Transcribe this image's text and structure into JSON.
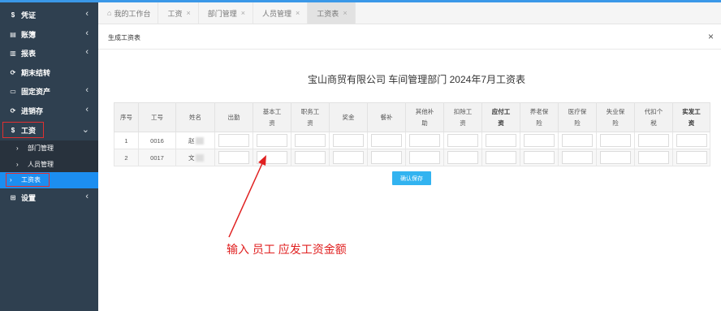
{
  "sidebar": {
    "items": [
      {
        "label": "凭证",
        "icon": "dollar-icon",
        "glyph": "$"
      },
      {
        "label": "账簿",
        "icon": "book-icon",
        "glyph": "▤"
      },
      {
        "label": "报表",
        "icon": "report-icon",
        "glyph": "▥"
      },
      {
        "label": "期末结转",
        "icon": "transfer-icon",
        "glyph": "⟳"
      },
      {
        "label": "固定资产",
        "icon": "monitor-icon",
        "glyph": "▭"
      },
      {
        "label": "进销存",
        "icon": "cycle-icon",
        "glyph": "⟳"
      },
      {
        "label": "工资",
        "icon": "dollar-icon",
        "glyph": "$"
      },
      {
        "label": "设置",
        "icon": "settings-grid-icon",
        "glyph": "⊞"
      }
    ],
    "chevron": "‹",
    "chevron_open": "⌄",
    "sub_items": [
      {
        "label": "部门管理"
      },
      {
        "label": "人员管理"
      },
      {
        "label": "工资表"
      }
    ],
    "sub_arrow": "›"
  },
  "tabs": [
    {
      "label": "我的工作台",
      "closable": false
    },
    {
      "label": "工资",
      "closable": true
    },
    {
      "label": "部门管理",
      "closable": true
    },
    {
      "label": "人员管理",
      "closable": true
    },
    {
      "label": "工资表",
      "closable": true,
      "active": true
    }
  ],
  "tab_close": "×",
  "panel": {
    "title": "生成工资表",
    "close": "×"
  },
  "sheet_title": "宝山商贸有限公司 车间管理部门 2024年7月工资表",
  "table": {
    "headers": [
      {
        "l1": "序号",
        "l2": ""
      },
      {
        "l1": "工号",
        "l2": ""
      },
      {
        "l1": "姓名",
        "l2": ""
      },
      {
        "l1": "出勤",
        "l2": ""
      },
      {
        "l1": "基本工",
        "l2": "资"
      },
      {
        "l1": "职务工",
        "l2": "资"
      },
      {
        "l1": "奖金",
        "l2": ""
      },
      {
        "l1": "餐补",
        "l2": ""
      },
      {
        "l1": "其他补",
        "l2": "助"
      },
      {
        "l1": "扣除工",
        "l2": "资"
      },
      {
        "l1": "应付工",
        "l2": "资"
      },
      {
        "l1": "养老保",
        "l2": "险"
      },
      {
        "l1": "医疗保",
        "l2": "险"
      },
      {
        "l1": "失业保",
        "l2": "险"
      },
      {
        "l1": "代扣个",
        "l2": "税"
      },
      {
        "l1": "实发工",
        "l2": "资"
      }
    ],
    "rows": [
      {
        "no": "1",
        "id": "0016",
        "name": "赵"
      },
      {
        "no": "2",
        "id": "0017",
        "name": "文"
      }
    ]
  },
  "confirm_label": "确认保存",
  "annotation": "输入 员工 应发工资金额",
  "colors": {
    "sidebar_bg": "#2f4050",
    "accent": "#1c8ef0",
    "button": "#32b3f0",
    "annotation": "#e02020"
  }
}
